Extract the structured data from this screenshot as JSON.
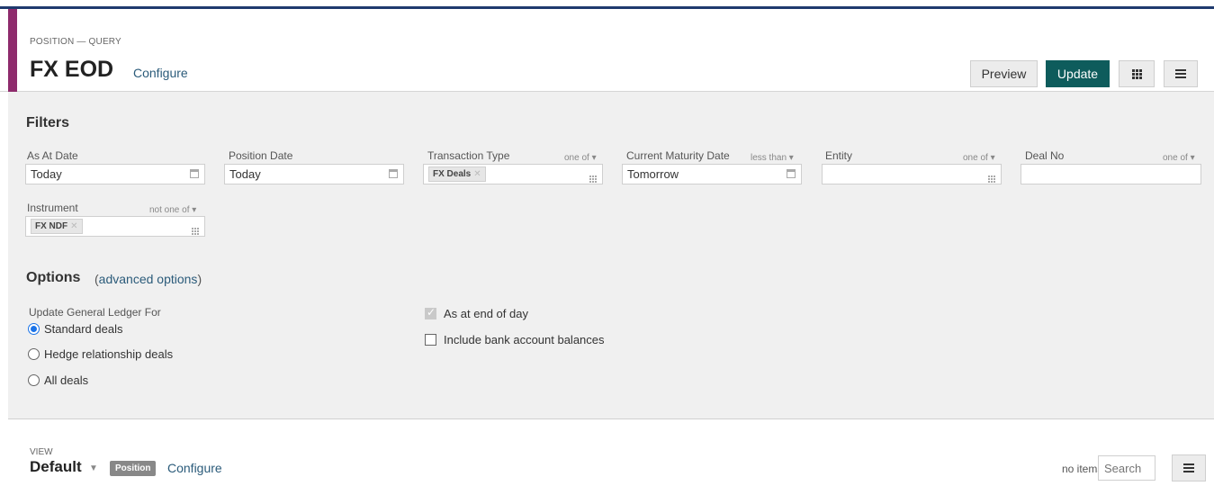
{
  "header": {
    "crumb": "POSITION — QUERY",
    "title": "FX EOD",
    "configure": "Configure",
    "buttons": {
      "preview": "Preview",
      "update": "Update"
    }
  },
  "filters": {
    "title": "Filters",
    "as_at_date": {
      "label": "As At Date",
      "value": "Today"
    },
    "position_date": {
      "label": "Position Date",
      "value": "Today"
    },
    "transaction_type": {
      "label": "Transaction Type",
      "op": "one of ▾",
      "chip": "FX Deals"
    },
    "current_maturity_date": {
      "label": "Current Maturity Date",
      "op": "less than ▾",
      "value": "Tomorrow"
    },
    "entity": {
      "label": "Entity",
      "op": "one of ▾",
      "value": ""
    },
    "deal_no": {
      "label": "Deal No",
      "op": "one of ▾",
      "value": ""
    },
    "instrument": {
      "label": "Instrument",
      "op": "not one of ▾",
      "chip": "FX NDF"
    }
  },
  "options": {
    "title": "Options",
    "advanced_prefix": "(",
    "advanced_link": "advanced options",
    "advanced_suffix": ")",
    "gl_label": "Update General Ledger For",
    "radio_standard": "Standard deals",
    "radio_hedge": "Hedge relationship deals",
    "radio_all": "All deals",
    "check_eod": "As at end of day",
    "check_bank": "Include bank account balances"
  },
  "view": {
    "label": "VIEW",
    "title": "Default",
    "badge": "Position",
    "configure": "Configure",
    "no_items": "no items",
    "search_placeholder": "Search"
  },
  "colors": {
    "accent": "#8e2b6c",
    "update_button": "#0e5c5c",
    "link": "#2b5b7a"
  },
  "icons": [
    "calendar-icon",
    "grid-icon",
    "menu-icon",
    "remove-chip-icon",
    "caret-down-icon"
  ]
}
